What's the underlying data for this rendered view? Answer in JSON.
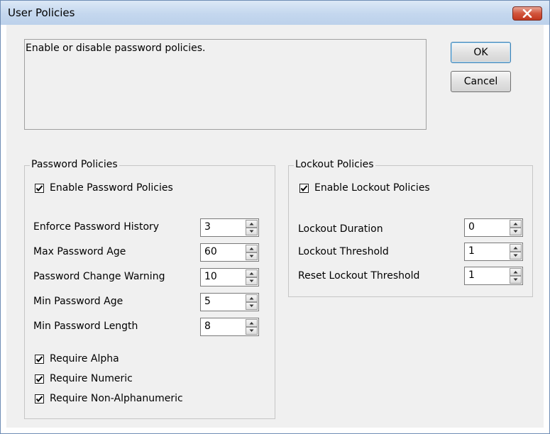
{
  "window": {
    "title": "User Policies"
  },
  "description": "Enable or disable password policies.",
  "buttons": {
    "ok": "OK",
    "cancel": "Cancel"
  },
  "password_policies": {
    "group_title": "Password Policies",
    "enable_label": "Enable Password Policies",
    "enable_checked": true,
    "fields": [
      {
        "label": "Enforce Password History",
        "value": "3"
      },
      {
        "label": "Max Password Age",
        "value": "60"
      },
      {
        "label": "Password Change Warning",
        "value": "10"
      },
      {
        "label": "Min Password Age",
        "value": "5"
      },
      {
        "label": "Min Password Length",
        "value": "8"
      }
    ],
    "requirements": [
      {
        "label": "Require Alpha",
        "checked": true
      },
      {
        "label": "Require Numeric",
        "checked": true
      },
      {
        "label": "Require Non-Alphanumeric",
        "checked": true
      }
    ]
  },
  "lockout_policies": {
    "group_title": "Lockout Policies",
    "enable_label": "Enable Lockout Policies",
    "enable_checked": true,
    "fields": [
      {
        "label": "Lockout Duration",
        "value": "0"
      },
      {
        "label": "Lockout Threshold",
        "value": "1"
      },
      {
        "label": "Reset Lockout Threshold",
        "value": "1"
      }
    ]
  },
  "icons": {
    "close": "close-icon",
    "check": "checkmark-icon",
    "spin_up": "arrow-up-icon",
    "spin_down": "arrow-down-icon"
  },
  "colors": {
    "titlebar": "#c4d7ee",
    "close_button": "#c1371f",
    "dialog_background": "#f0f0f0"
  }
}
